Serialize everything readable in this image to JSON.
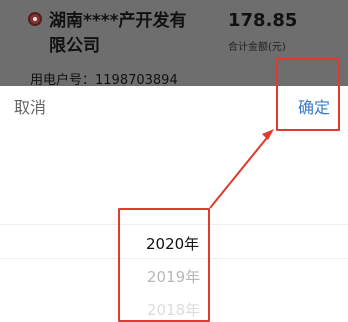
{
  "background_card": {
    "company_name": "湖南****产开发有限公司",
    "amount": "178.85",
    "amount_label": "合计金额(元)",
    "user_id": "用电户号：1198703894"
  },
  "toolbar": {
    "cancel_label": "取消",
    "confirm_label": "确定"
  },
  "picker": {
    "years": [
      "2020年",
      "2019年",
      "2018年"
    ],
    "selected_index": 0
  },
  "colors": {
    "accent": "#3a79c8",
    "annotation_red": "#e23a2e"
  }
}
